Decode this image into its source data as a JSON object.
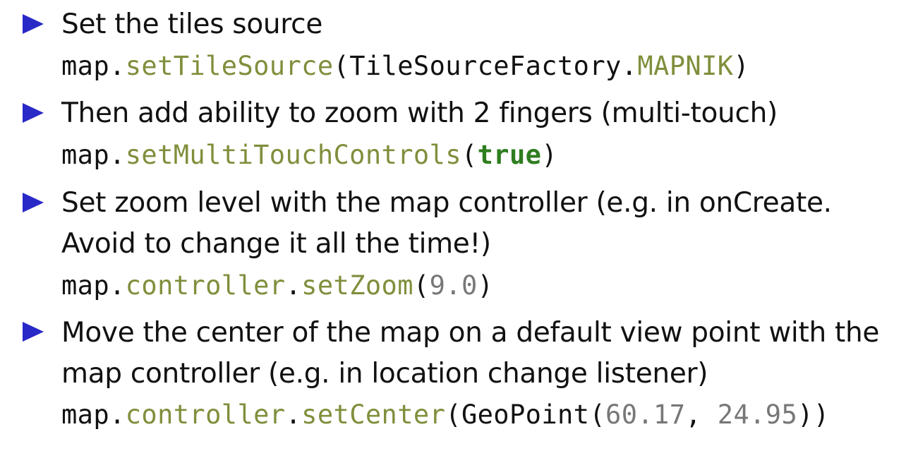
{
  "bullets": [
    {
      "text": [
        "Set the tiles source"
      ],
      "code": [
        {
          "t": "map.",
          "c": "plain"
        },
        {
          "t": "setTileSource",
          "c": "method"
        },
        {
          "t": "(TileSourceFactory.",
          "c": "plain"
        },
        {
          "t": "MAPNIK",
          "c": "method"
        },
        {
          "t": ")",
          "c": "plain"
        }
      ]
    },
    {
      "text": [
        "Then add ability to zoom with 2 fingers (multi-touch)"
      ],
      "code": [
        {
          "t": "map.",
          "c": "plain"
        },
        {
          "t": "setMultiTouchControls",
          "c": "method"
        },
        {
          "t": "(",
          "c": "plain"
        },
        {
          "t": "true",
          "c": "keyword"
        },
        {
          "t": ")",
          "c": "plain"
        }
      ]
    },
    {
      "text": [
        "Set zoom level with the map controller (e.g.  in onCreate.",
        "Avoid to change it all the time!)"
      ],
      "code": [
        {
          "t": "map.",
          "c": "plain"
        },
        {
          "t": "controller",
          "c": "method"
        },
        {
          "t": ".",
          "c": "plain"
        },
        {
          "t": "setZoom",
          "c": "method"
        },
        {
          "t": "(",
          "c": "plain"
        },
        {
          "t": "9.0",
          "c": "number"
        },
        {
          "t": ")",
          "c": "plain"
        }
      ]
    },
    {
      "text": [
        "Move the center of the map on a default view point with the",
        "map controller (e.g.  in location change listener)"
      ],
      "code": [
        {
          "t": "map.",
          "c": "plain"
        },
        {
          "t": "controller",
          "c": "method"
        },
        {
          "t": ".",
          "c": "plain"
        },
        {
          "t": "setCenter",
          "c": "method"
        },
        {
          "t": "(GeoPoint(",
          "c": "plain"
        },
        {
          "t": "60.17",
          "c": "number"
        },
        {
          "t": ", ",
          "c": "plain"
        },
        {
          "t": "24.95",
          "c": "number"
        },
        {
          "t": "))",
          "c": "plain"
        }
      ]
    }
  ],
  "colors": {
    "bullet": "#2929c8",
    "method": "#7f8f3c",
    "number": "#777777",
    "keyword": "#2e7d1f",
    "text": "#111111"
  }
}
